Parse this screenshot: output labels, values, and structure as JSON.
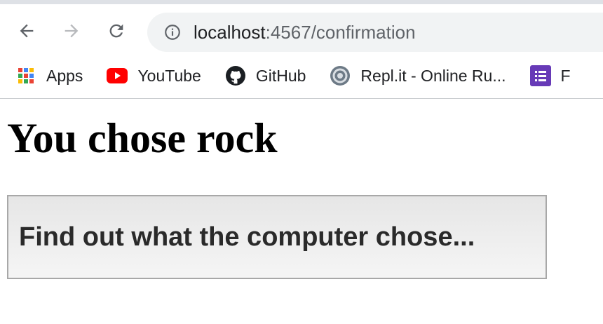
{
  "browser": {
    "url_host": "localhost",
    "url_rest": ":4567/confirmation",
    "nav": {
      "back": "back-arrow",
      "forward": "forward-arrow",
      "reload": "reload"
    }
  },
  "bookmarks": [
    {
      "label": "Apps",
      "icon": "apps-grid-icon"
    },
    {
      "label": "YouTube",
      "icon": "youtube-icon"
    },
    {
      "label": "GitHub",
      "icon": "github-icon"
    },
    {
      "label": "Repl.it - Online Ru...",
      "icon": "replit-icon"
    },
    {
      "label": "F",
      "icon": "forms-icon"
    }
  ],
  "page": {
    "heading": "You chose rock",
    "button_label": "Find out what the computer chose..."
  }
}
